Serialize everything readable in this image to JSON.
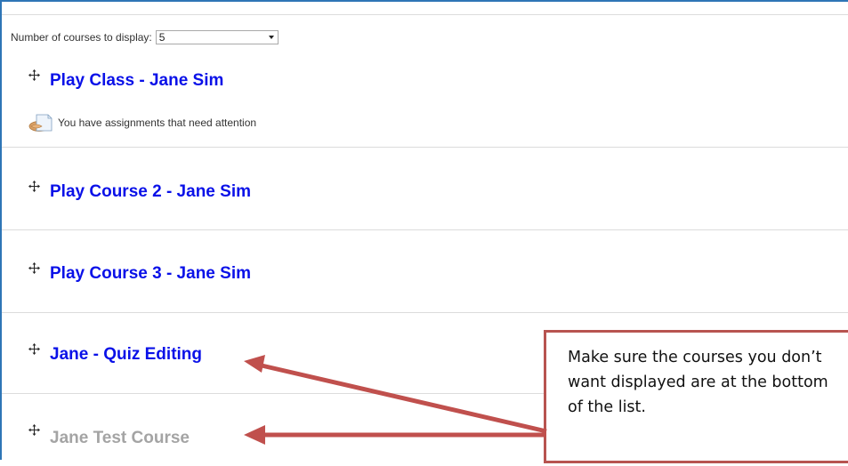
{
  "display_control": {
    "label": "Number of courses to display:",
    "selected_value": "5"
  },
  "courses": [
    {
      "title": "Play Class - Jane Sim",
      "hidden": false
    },
    {
      "title": "Play Course 2 - Jane Sim",
      "hidden": false
    },
    {
      "title": "Play Course 3 - Jane Sim",
      "hidden": false
    },
    {
      "title": "Jane - Quiz Editing",
      "hidden": false
    },
    {
      "title": "Jane Test Course",
      "hidden": true
    }
  ],
  "notices": {
    "assignments": "You have assignments that need attention"
  },
  "callout": {
    "text": "Make sure the courses you don’t want displayed are at the bottom of the list."
  },
  "colors": {
    "link": "#0a11e8",
    "hidden_link": "#a4a4a4",
    "callout_border": "#b85450",
    "arrow": "#c0504d",
    "frame": "#2e75b6"
  },
  "icons": {
    "move": "move-arrows-icon",
    "assignment": "assignment-icon"
  }
}
